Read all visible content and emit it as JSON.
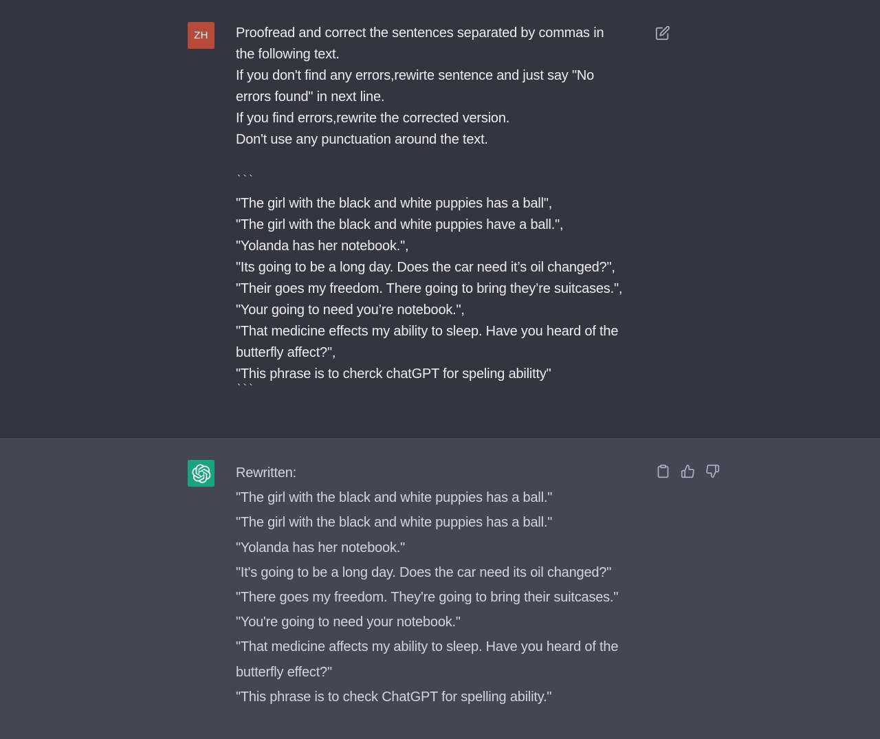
{
  "user_message": {
    "avatar_initials": "ZH",
    "lines": [
      "Proofread and correct the sentences separated by commas in",
      "the following text.",
      "If you don't find any errors,rewirte sentence and just say \"No",
      "errors found\" in next line.",
      "If you find errors,rewrite the corrected version.",
      "Don't use any punctuation around the text."
    ],
    "code_fence_open": "` ` `",
    "quoted_lines": [
      "\"The girl with the black and white puppies has a ball\",",
      "\"The girl with the black and white puppies have a ball.\",",
      "\"Yolanda has her notebook.\",",
      "\"Its going to be a long day. Does the car need it’s oil changed?\",",
      "\"Their goes my freedom. There going to bring they’re suitcases.\",",
      "\"Your going to need you’re notebook.\",",
      "\"That medicine effects my ability to sleep. Have you heard of the",
      "butterfly affect?\",",
      "\"This phrase is to cherck chatGPT for speling abilitty\""
    ],
    "code_fence_close": "` ` `",
    "edit_icon": "edit-icon"
  },
  "assistant_message": {
    "avatar_icon": "openai-logo-icon",
    "lines": [
      "Rewritten:",
      "\"The girl with the black and white puppies has a ball.\"",
      "\"The girl with the black and white puppies has a ball.\"",
      "\"Yolanda has her notebook.\"",
      "\"It's going to be a long day. Does the car need its oil changed?\"",
      "\"There goes my freedom. They're going to bring their suitcases.\"",
      "\"You're going to need your notebook.\"",
      "\"That medicine affects my ability to sleep. Have you heard of the",
      "butterfly effect?\"",
      "\"This phrase is to check ChatGPT for spelling ability.\""
    ],
    "action_icons": [
      "clipboard-icon",
      "thumbs-up-icon",
      "thumbs-down-icon"
    ]
  },
  "colors": {
    "user_bg": "#343541",
    "assistant_bg": "#444654",
    "user_avatar": "#b64b3a",
    "bot_avatar": "#19a37f",
    "user_text": "#ececf1",
    "assistant_text": "#d1d5db",
    "icon": "#acacbe"
  }
}
